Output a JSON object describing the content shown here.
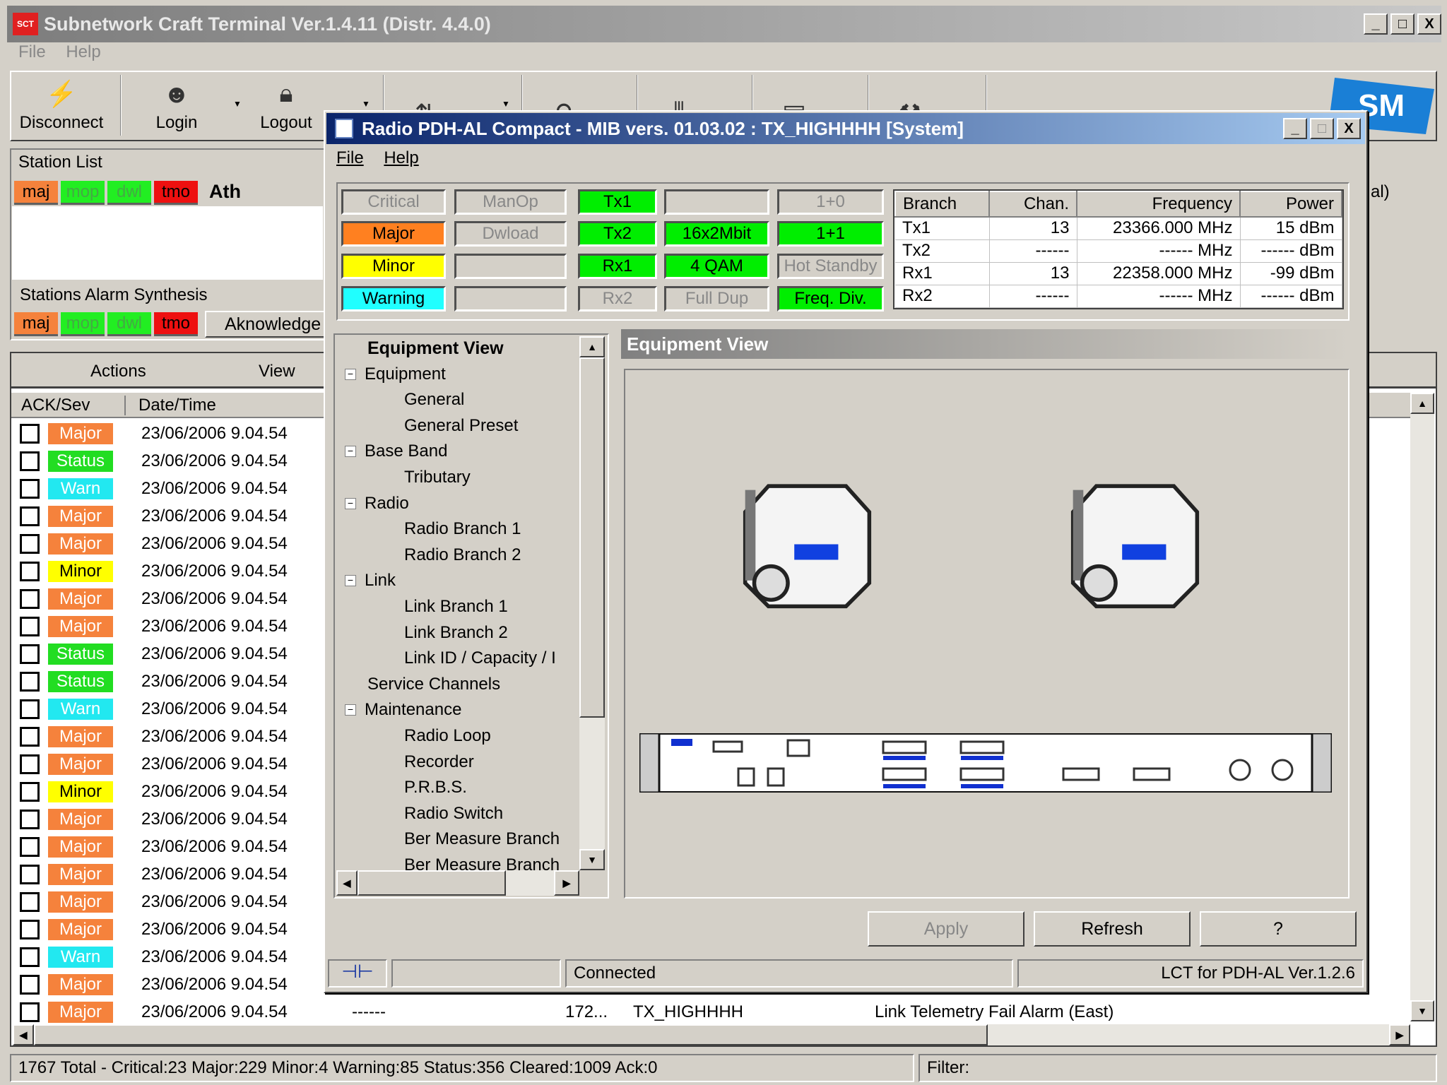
{
  "main": {
    "title": "Subnetwork Craft Terminal  Ver.1.4.11  (Distr. 4.4.0)",
    "logo_icon": "sm-logo-icon",
    "menu": [
      "File",
      "Help"
    ],
    "toolbar": [
      {
        "label": "Disconnect",
        "icon": "plug-icon"
      },
      {
        "label": "Login",
        "icon": "user-key-icon"
      },
      {
        "label": "Logout",
        "icon": "lock-icon"
      },
      {
        "label": "",
        "icon": "refresh-icon"
      },
      {
        "label": "",
        "icon": "search-icon"
      },
      {
        "label": "",
        "icon": "equalizer-icon"
      },
      {
        "label": "",
        "icon": "document-icon"
      },
      {
        "label": "",
        "icon": "tools-icon"
      }
    ],
    "station_list": {
      "title": "Station List",
      "badges": [
        "maj",
        "mop",
        "dwl",
        "tmo"
      ],
      "station": "Ath"
    },
    "alarm_synthesis": {
      "title": "Stations Alarm Synthesis",
      "badges": [
        "maj",
        "mop",
        "dwl",
        "tmo"
      ],
      "ack_button": "Aknowledge"
    },
    "actions_label": "Actions",
    "view_label": "View",
    "columns": [
      "ACK/Sev",
      "Date/Time"
    ],
    "right_fragment": "al)",
    "rows": [
      {
        "sev": "Major",
        "time": "23/06/2006 9.04.54"
      },
      {
        "sev": "Status",
        "time": "23/06/2006 9.04.54"
      },
      {
        "sev": "Warn",
        "time": "23/06/2006 9.04.54"
      },
      {
        "sev": "Major",
        "time": "23/06/2006 9.04.54"
      },
      {
        "sev": "Major",
        "time": "23/06/2006 9.04.54"
      },
      {
        "sev": "Minor",
        "time": "23/06/2006 9.04.54"
      },
      {
        "sev": "Major",
        "time": "23/06/2006 9.04.54"
      },
      {
        "sev": "Major",
        "time": "23/06/2006 9.04.54"
      },
      {
        "sev": "Status",
        "time": "23/06/2006 9.04.54"
      },
      {
        "sev": "Status",
        "time": "23/06/2006 9.04.54"
      },
      {
        "sev": "Warn",
        "time": "23/06/2006 9.04.54"
      },
      {
        "sev": "Major",
        "time": "23/06/2006 9.04.54"
      },
      {
        "sev": "Major",
        "time": "23/06/2006 9.04.54"
      },
      {
        "sev": "Minor",
        "time": "23/06/2006 9.04.54"
      },
      {
        "sev": "Major",
        "time": "23/06/2006 9.04.54"
      },
      {
        "sev": "Major",
        "time": "23/06/2006 9.04.54"
      },
      {
        "sev": "Major",
        "time": "23/06/2006 9.04.54"
      },
      {
        "sev": "Major",
        "time": "23/06/2006 9.04.54"
      },
      {
        "sev": "Major",
        "time": "23/06/2006 9.04.54"
      },
      {
        "sev": "Warn",
        "time": "23/06/2006 9.04.54"
      },
      {
        "sev": "Major",
        "time": "23/06/2006 9.04.54"
      },
      {
        "sev": "Major",
        "time": "23/06/2006 9.04.54",
        "c3": "------",
        "c4": "172...",
        "c5": "TX_HIGHHHH",
        "c6": "Link Telemetry Fail Alarm (East)"
      }
    ],
    "status_bar": {
      "summary": "1767 Total - Critical:23  Major:229  Minor:4  Warning:85  Status:356  Cleared:1009  Ack:0",
      "filter": "Filter:"
    }
  },
  "dialog": {
    "title": "Radio PDH-AL Compact - MIB vers. 01.03.02 : TX_HIGHHHH [System]",
    "menu": [
      "File",
      "Help"
    ],
    "status_cells": [
      [
        "Critical",
        "ManOp",
        "Tx1",
        "",
        "1+0"
      ],
      [
        "Major",
        "Dwload",
        "Tx2",
        "16x2Mbit",
        "1+1"
      ],
      [
        "Minor",
        "",
        "Rx1",
        "4 QAM",
        "Hot Standby"
      ],
      [
        "Warning",
        "",
        "Rx2",
        "Full Dup",
        "Freq. Div."
      ]
    ],
    "status_active": [
      [
        "off",
        "off",
        "green",
        "off",
        "off"
      ],
      [
        "orange",
        "off",
        "green",
        "green",
        "green"
      ],
      [
        "yellow",
        "off",
        "green",
        "green",
        "off"
      ],
      [
        "cyan",
        "off",
        "off",
        "off",
        "green"
      ]
    ],
    "branch_table": {
      "headers": [
        "Branch",
        "Chan.",
        "Frequency",
        "Power"
      ],
      "rows": [
        [
          "Tx1",
          "13",
          "23366.000 MHz",
          "15 dBm"
        ],
        [
          "Tx2",
          "------",
          "------ MHz",
          "------ dBm"
        ],
        [
          "Rx1",
          "13",
          "22358.000 MHz",
          "-99 dBm"
        ],
        [
          "Rx2",
          "------",
          "------ MHz",
          "------ dBm"
        ]
      ]
    },
    "tree": [
      {
        "label": "Equipment View",
        "level": 0,
        "bold": true
      },
      {
        "label": "Equipment",
        "level": 0,
        "exp": true
      },
      {
        "label": "General",
        "level": 1
      },
      {
        "label": "General Preset",
        "level": 1
      },
      {
        "label": "Base Band",
        "level": 0,
        "exp": true
      },
      {
        "label": "Tributary",
        "level": 1
      },
      {
        "label": "Radio",
        "level": 0,
        "exp": true
      },
      {
        "label": "Radio Branch 1",
        "level": 1
      },
      {
        "label": "Radio Branch 2",
        "level": 1
      },
      {
        "label": "Link",
        "level": 0,
        "exp": true
      },
      {
        "label": "Link Branch 1",
        "level": 1
      },
      {
        "label": "Link Branch 2",
        "level": 1
      },
      {
        "label": "Link ID / Capacity / I",
        "level": 1
      },
      {
        "label": "Service Channels",
        "level": 0
      },
      {
        "label": "Maintenance",
        "level": 0,
        "exp": true
      },
      {
        "label": "Radio Loop",
        "level": 1
      },
      {
        "label": "Recorder",
        "level": 1
      },
      {
        "label": "P.R.B.S.",
        "level": 1
      },
      {
        "label": "Radio Switch",
        "level": 1
      },
      {
        "label": "Ber Measure Branch",
        "level": 1
      },
      {
        "label": "Ber Measure Branch",
        "level": 1
      }
    ],
    "view_title": "Equipment View",
    "buttons": {
      "apply": "Apply",
      "refresh": "Refresh",
      "help": "?"
    },
    "status": {
      "connection": "Connected",
      "version": "LCT for PDH-AL Ver.1.2.6"
    }
  },
  "colors": {
    "Major": "#f5823c",
    "Status": "#22dd22",
    "Warn": "#22e8f0",
    "Minor": "#ffff00",
    "orange": "#ff8020",
    "yellow": "#ffff00",
    "green": "#00ee00",
    "cyan": "#20ffff",
    "red": "#ee1010"
  }
}
